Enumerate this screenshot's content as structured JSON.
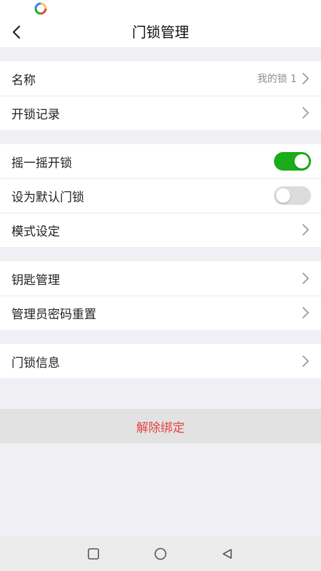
{
  "colors": {
    "accent_green": "#1aad19",
    "danger_red": "#e64340",
    "background": "#f0eff4",
    "toggle_off": "#dcdcdc"
  },
  "status_bar": {
    "app_icon": "color-ring-app-icon"
  },
  "header": {
    "title": "门锁管理",
    "back_icon": "chevron-left-icon"
  },
  "groups": [
    {
      "items": [
        {
          "label": "名称",
          "value": "我的锁 1",
          "control": "chevron"
        },
        {
          "label": "开锁记录",
          "control": "chevron"
        }
      ]
    },
    {
      "items": [
        {
          "label": "摇一摇开锁",
          "control": "toggle",
          "toggle_on": true
        },
        {
          "label": "设为默认门锁",
          "control": "toggle",
          "toggle_on": false
        },
        {
          "label": "模式设定",
          "control": "chevron"
        }
      ]
    },
    {
      "items": [
        {
          "label": "钥匙管理",
          "control": "chevron"
        },
        {
          "label": "管理员密码重置",
          "control": "chevron"
        }
      ]
    },
    {
      "items": [
        {
          "label": "门锁信息",
          "control": "chevron"
        }
      ]
    }
  ],
  "unbind": {
    "label": "解除绑定"
  },
  "system_nav": {
    "recent_icon": "square-icon",
    "home_icon": "circle-icon",
    "back_icon": "triangle-back-icon"
  }
}
